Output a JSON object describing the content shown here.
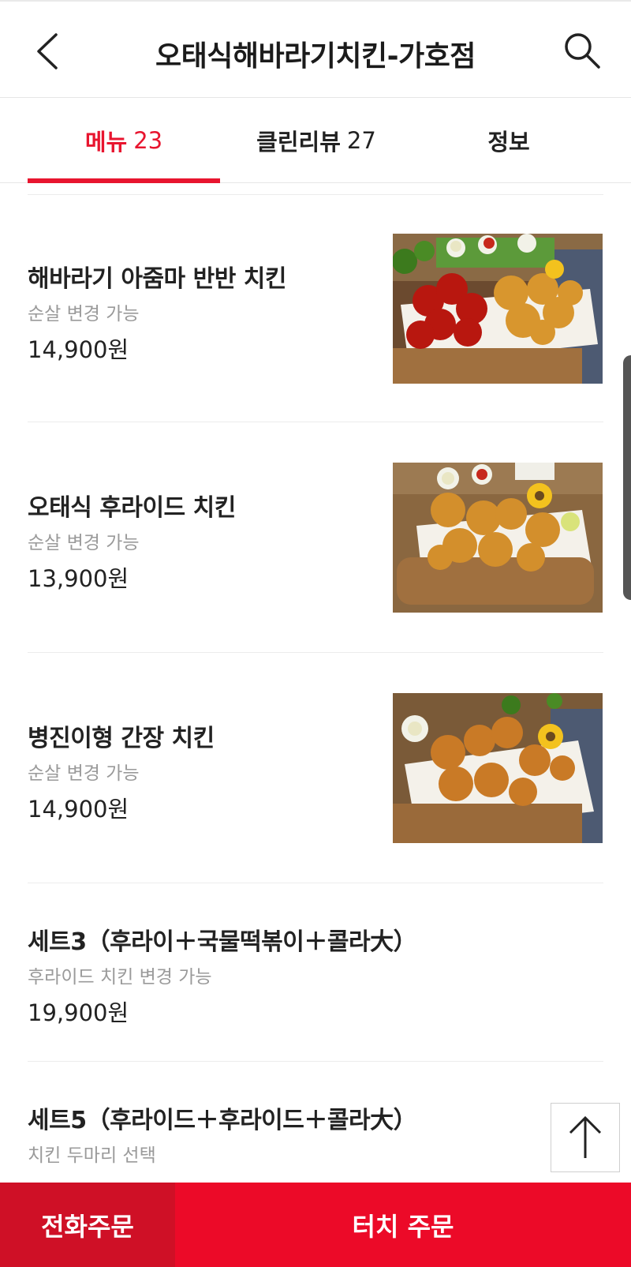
{
  "header": {
    "title": "오태식해바라기치킨-가호점"
  },
  "tabs": [
    {
      "label": "메뉴",
      "count": "23"
    },
    {
      "label": "클린리뷰",
      "count": "27"
    },
    {
      "label": "정보",
      "count": ""
    }
  ],
  "menu": [
    {
      "name": "해바라기 아줌마 반반 치킨",
      "desc": "순살 변경 가능",
      "price": "14,900원"
    },
    {
      "name": "오태식 후라이드 치킨",
      "desc": "순살 변경 가능",
      "price": "13,900원"
    },
    {
      "name": "병진이형 간장 치킨",
      "desc": "순살 변경 가능",
      "price": "14,900원"
    },
    {
      "name": "세트3（후라이＋국물떡볶이＋콜라大）",
      "desc": "후라이드 치킨 변경 가능",
      "price": "19,900원"
    },
    {
      "name": "세트5（후라이드＋후라이드＋콜라大）",
      "desc": "치킨 두마리 선택",
      "price": ""
    }
  ],
  "bottom": {
    "call_order": "전화주문",
    "touch_order": "터치 주문"
  },
  "colors": {
    "accent": "#e8152f",
    "call_bg": "#cf1026",
    "touch_bg": "#ec0a28"
  },
  "icons": [
    "back-arrow-icon",
    "search-icon",
    "arrow-up-icon"
  ]
}
